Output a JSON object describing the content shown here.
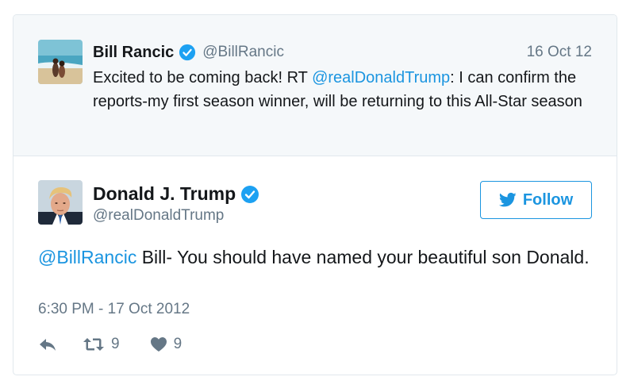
{
  "parent_tweet": {
    "name": "Bill Rancic",
    "handle": "@BillRancic",
    "date": "16 Oct 12",
    "text_before": "Excited to be coming back! RT ",
    "mention": "@realDonaldTrump",
    "text_after": ": I can confirm the reports-my first season winner, will be returning to this All-Star season"
  },
  "tweet": {
    "name": "Donald J. Trump",
    "handle": "@realDonaldTrump",
    "follow_label": "Follow",
    "mention": "@BillRancic",
    "text": " Bill- You should have named your beautiful son Donald.",
    "timestamp": "6:30 PM - 17 Oct 2012",
    "retweet_count": "9",
    "like_count": "9"
  },
  "colors": {
    "link": "#1b95e0",
    "verified": "#1da1f2",
    "muted": "#657786",
    "parent_bg": "#f5f8fa"
  },
  "icons": {
    "verified": "verified-badge-icon",
    "twitter": "twitter-bird-icon",
    "reply": "reply-icon",
    "retweet": "retweet-icon",
    "like": "heart-icon"
  }
}
